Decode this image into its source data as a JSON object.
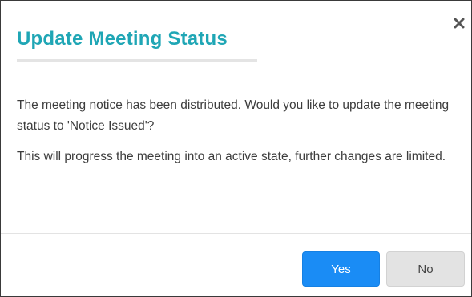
{
  "dialog": {
    "title": "Update Meeting Status",
    "close_icon": "close-icon",
    "paragraphs": [
      "The meeting notice has been distributed. Would you like to update the meeting status to 'Notice Issued'?",
      "This will progress the meeting into an active state, further changes are limited."
    ],
    "buttons": {
      "yes_label": "Yes",
      "no_label": "No"
    }
  },
  "colors": {
    "title": "#1fa6b5",
    "primary_button": "#1a8cf5",
    "secondary_button": "#e3e3e3",
    "body_text": "#3d3d3d"
  }
}
